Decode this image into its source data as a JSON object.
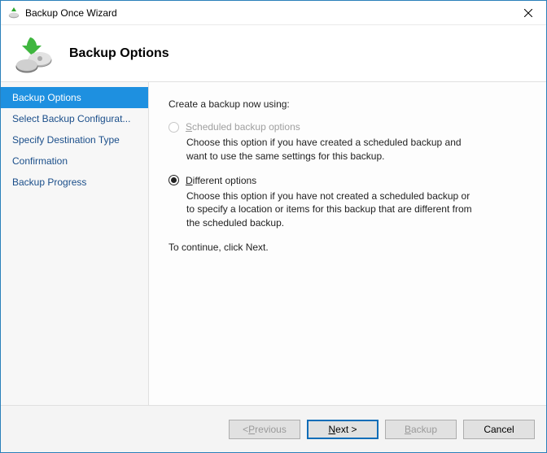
{
  "titlebar": {
    "title": "Backup Once Wizard"
  },
  "header": {
    "title": "Backup Options"
  },
  "sidebar": {
    "items": [
      {
        "label": "Backup Options",
        "active": true
      },
      {
        "label": "Select Backup Configurat...",
        "active": false
      },
      {
        "label": "Specify Destination Type",
        "active": false
      },
      {
        "label": "Confirmation",
        "active": false
      },
      {
        "label": "Backup Progress",
        "active": false
      }
    ]
  },
  "content": {
    "prompt": "Create a backup now using:",
    "option1": {
      "label_pre": "S",
      "label_rest": "cheduled backup options",
      "desc": "Choose this option if you have created a scheduled backup and want to use the same settings for this backup.",
      "enabled": false,
      "checked": false
    },
    "option2": {
      "label_pre": "D",
      "label_rest": "ifferent options",
      "desc": "Choose this option if you have not created a scheduled backup or to specify a location or items for this backup that are different from the scheduled backup.",
      "enabled": true,
      "checked": true
    },
    "continue": "To continue, click Next."
  },
  "footer": {
    "previous_pre": "< ",
    "previous_u": "P",
    "previous_rest": "revious",
    "next_u": "N",
    "next_rest": "ext >",
    "backup_u": "B",
    "backup_rest": "ackup",
    "cancel": "Cancel"
  }
}
